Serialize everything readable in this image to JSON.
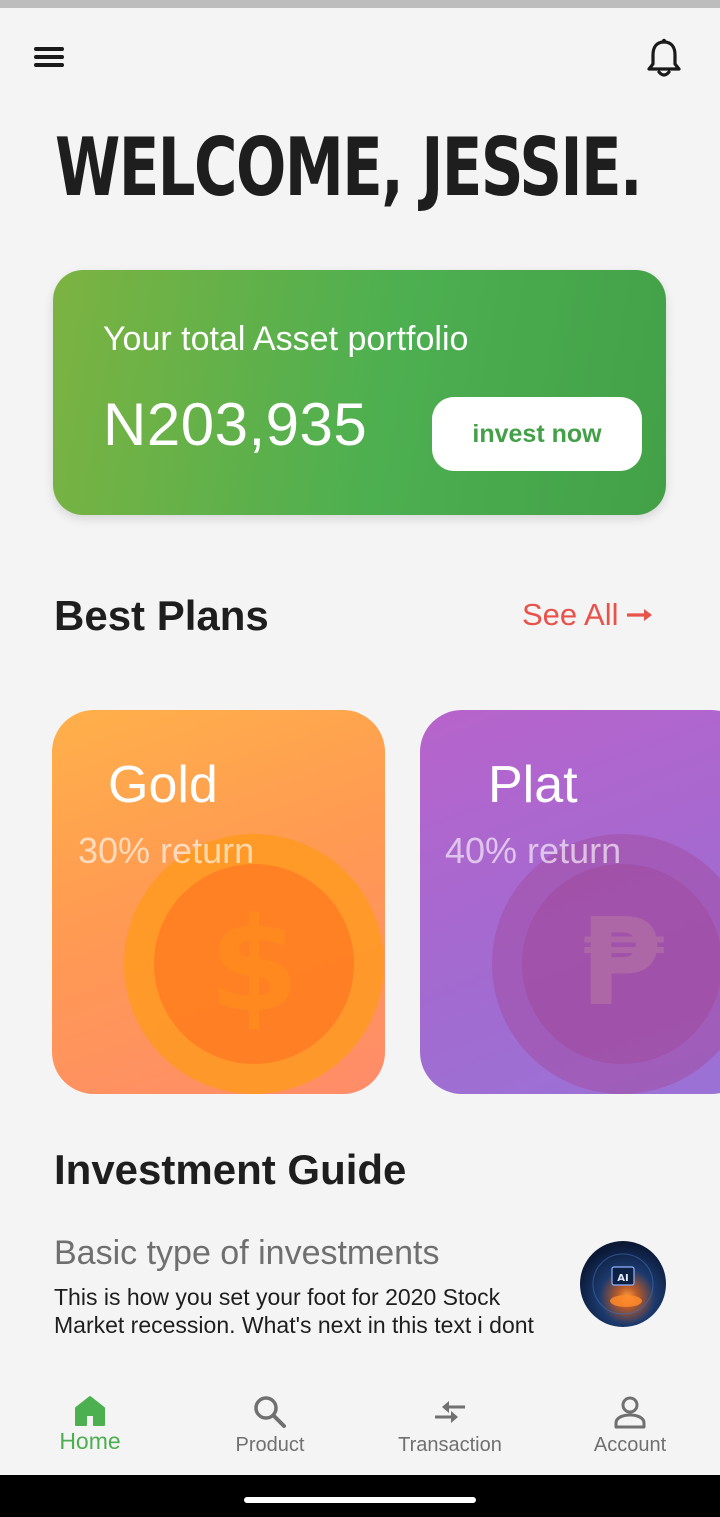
{
  "header": {
    "menu_icon": "hamburger-menu-icon",
    "notification_icon": "bell-icon"
  },
  "welcome": {
    "title": "WELCOME, JESSIE."
  },
  "portfolio": {
    "label": "Your total Asset portfolio",
    "value": "N203,935",
    "cta_label": "invest now"
  },
  "plans": {
    "title": "Best Plans",
    "see_all_label": "See All",
    "see_all_icon": "arrow-right-icon",
    "items": [
      {
        "name": "Gold",
        "return_label": "30% return",
        "icon": "dollar-coin-icon"
      },
      {
        "name": "Plat",
        "return_label": "40% return",
        "icon": "peso-coin-icon"
      }
    ]
  },
  "guide": {
    "title": "Investment Guide",
    "articles": [
      {
        "title": "Basic type of investments",
        "body": "This is how you set your foot for 2020 Stock Market recession. What's next in this text i dont",
        "thumb_icon": "ai-thumbnail-image",
        "thumb_text": "AI"
      }
    ]
  },
  "bottom_nav": {
    "items": [
      {
        "label": "Home",
        "icon": "home-icon",
        "active": true
      },
      {
        "label": "Product",
        "icon": "search-icon",
        "active": false
      },
      {
        "label": "Transaction",
        "icon": "transfer-arrows-icon",
        "active": false
      },
      {
        "label": "Account",
        "icon": "person-icon",
        "active": false
      }
    ]
  },
  "colors": {
    "background": "#f4f4f4",
    "accent_green": "#4caf50",
    "see_all_red": "#e8524a",
    "gold_card": "#ff9f4a",
    "plat_card": "#a96ad0",
    "nav_inactive": "#707070"
  }
}
